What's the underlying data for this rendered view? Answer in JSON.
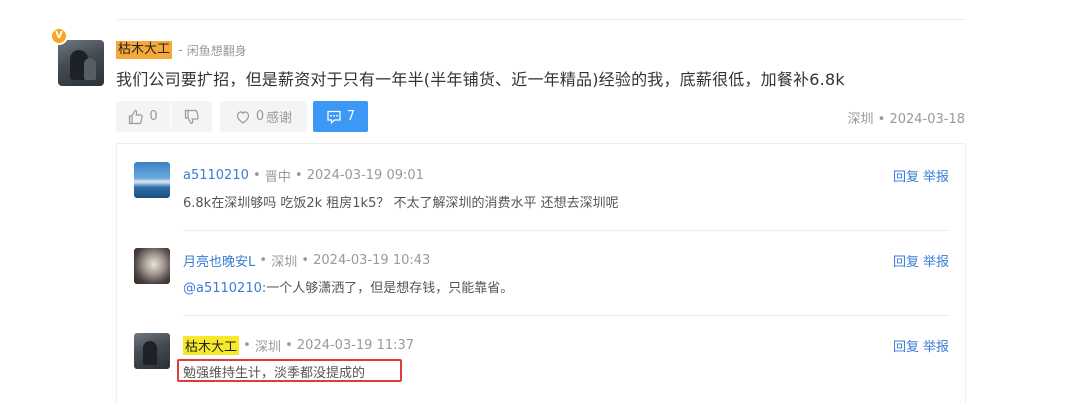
{
  "post": {
    "badge": "V",
    "author": "枯木大工",
    "separator": "-",
    "author_title": "闲鱼想翻身",
    "content": "我们公司要扩招，但是薪资对于只有一年半(半年铺货、近一年精品)经验的我，底薪很低，加餐补6.8k",
    "likes": "0",
    "thanks_count": "0",
    "thanks_label": "感谢",
    "comments": "7",
    "location": "深圳",
    "date": "2024-03-18"
  },
  "replies": [
    {
      "user": "a5110210",
      "location": "晋中",
      "time": "2024-03-19 09:01",
      "text": "6.8k在深圳够吗 吃饭2k 租房1k5？ 不太了解深圳的消费水平 还想去深圳呢",
      "reply_label": "回复",
      "report_label": "举报"
    },
    {
      "user": "月亮也晚安L",
      "location": "深圳",
      "time": "2024-03-19 10:43",
      "mention": "@a5110210:",
      "text": "一个人够潇洒了，但是想存钱，只能靠省。",
      "reply_label": "回复",
      "report_label": "举报"
    },
    {
      "user": "枯木大工",
      "location": "深圳",
      "time": "2024-03-19 11:37",
      "text": "勉强维持生计，淡季都没提成的",
      "reply_label": "回复",
      "report_label": "举报"
    }
  ],
  "colors": {
    "accent_blue": "#3b98f5",
    "link_blue": "#3b7bd6",
    "author_highlight": "#f6a83a",
    "reply_highlight": "#f7e82a",
    "annotation_red": "#e03a3a"
  },
  "icons": {
    "like": "thumbs-up-icon",
    "dislike": "thumbs-down-icon",
    "thanks": "heart-icon",
    "comment": "comment-icon",
    "badge": "vip-badge-icon"
  }
}
